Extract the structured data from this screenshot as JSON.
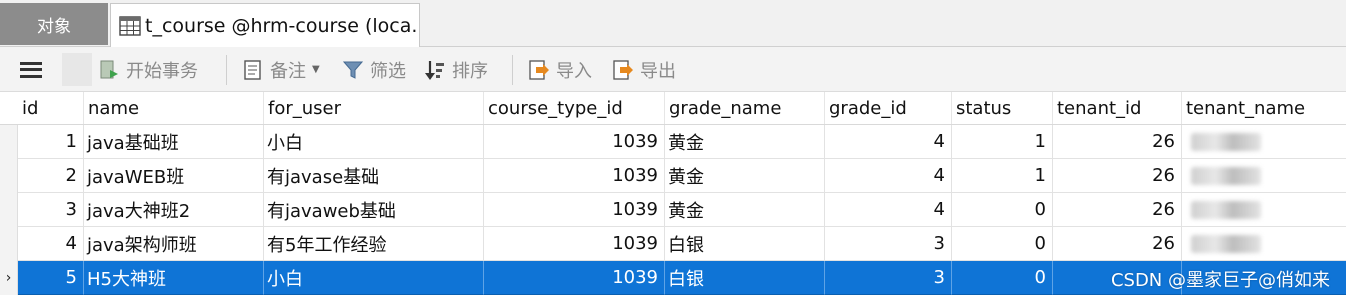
{
  "tabs": {
    "objects_label": "对象",
    "table_tab_label": "t_course @hrm-course (loca..."
  },
  "toolbar": {
    "begin_transaction": "开始事务",
    "memo": "备注",
    "filter": "筛选",
    "sort": "排序",
    "import": "导入",
    "export": "导出"
  },
  "grid": {
    "columns": [
      "id",
      "name",
      "for_user",
      "course_type_id",
      "grade_name",
      "grade_id",
      "status",
      "tenant_id",
      "tenant_name"
    ],
    "rows": [
      {
        "id": "1",
        "name": "java基础班",
        "for_user": "小白",
        "course_type_id": "1039",
        "grade_name": "黄金",
        "grade_id": "4",
        "status": "1",
        "tenant_id": "26"
      },
      {
        "id": "2",
        "name": "javaWEB班",
        "for_user": "有javase基础",
        "course_type_id": "1039",
        "grade_name": "黄金",
        "grade_id": "4",
        "status": "1",
        "tenant_id": "26"
      },
      {
        "id": "3",
        "name": "java大神班2",
        "for_user": "有javaweb基础",
        "course_type_id": "1039",
        "grade_name": "黄金",
        "grade_id": "4",
        "status": "0",
        "tenant_id": "26"
      },
      {
        "id": "4",
        "name": "java架构师班",
        "for_user": "有5年工作经验",
        "course_type_id": "1039",
        "grade_name": "白银",
        "grade_id": "3",
        "status": "0",
        "tenant_id": "26"
      },
      {
        "id": "5",
        "name": "H5大神班",
        "for_user": "小白",
        "course_type_id": "1039",
        "grade_name": "白银",
        "grade_id": "3",
        "status": "0",
        "tenant_id": ""
      }
    ],
    "current_row_marker": "›"
  },
  "watermark": "CSDN @墨家巨子@俏如来",
  "colors": {
    "selection": "#0f74d6",
    "objects_tab": "#8c8c8c",
    "toolbar_bg": "#f3f3f3"
  },
  "icons": [
    "menu-icon",
    "table-icon",
    "begin-transaction-icon",
    "memo-icon",
    "filter-icon",
    "sort-icon",
    "import-icon",
    "export-icon"
  ]
}
